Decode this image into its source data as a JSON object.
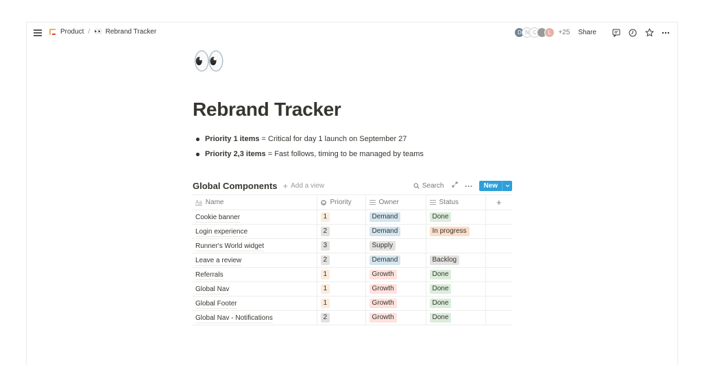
{
  "breadcrumb": {
    "items": [
      {
        "label": "Product",
        "icon": "crane-icon"
      },
      {
        "label": "Rebrand Tracker",
        "icon": "eyes-emoji"
      }
    ],
    "separator": "/"
  },
  "topbar": {
    "avatars": [
      {
        "initial": "D",
        "style": "av-d"
      },
      {
        "initial": "N",
        "style": "av-n"
      },
      {
        "initial": "C",
        "style": "av-c"
      },
      {
        "initial": "",
        "style": "av-p"
      },
      {
        "initial": "L",
        "style": "av-l"
      }
    ],
    "more_count": "+25",
    "share_label": "Share",
    "icons": [
      "comment-icon",
      "history-icon",
      "star-icon",
      "more-icon"
    ]
  },
  "page": {
    "emoji": "👀",
    "title": "Rebrand Tracker",
    "bullets": [
      {
        "bold": "Priority 1 items",
        "text": " = Critical for day 1 launch on September 27"
      },
      {
        "bold": "Priority 2,3 items",
        "text": " = Fast follows, timing to be managed by teams"
      }
    ]
  },
  "database": {
    "title": "Global Components",
    "add_view_label": "Add a view",
    "search_label": "Search",
    "new_label": "New",
    "columns": [
      {
        "label": "Name",
        "icon": "text-icon"
      },
      {
        "label": "Priority",
        "icon": "select-icon"
      },
      {
        "label": "Owner",
        "icon": "list-icon"
      },
      {
        "label": "Status",
        "icon": "list-icon"
      }
    ],
    "rows": [
      {
        "name": "Cookie banner",
        "priority": "1",
        "owner": "Demand",
        "status": "Done"
      },
      {
        "name": "Login experience",
        "priority": "2",
        "owner": "Demand",
        "status": "In progress"
      },
      {
        "name": "Runner's World widget",
        "priority": "3",
        "owner": "Supply",
        "status": ""
      },
      {
        "name": "Leave a review",
        "priority": "2",
        "owner": "Demand",
        "status": "Backlog"
      },
      {
        "name": "Referrals",
        "priority": "1",
        "owner": "Growth",
        "status": "Done"
      },
      {
        "name": "Global Nav",
        "priority": "1",
        "owner": "Growth",
        "status": "Done"
      },
      {
        "name": "Global Footer",
        "priority": "1",
        "owner": "Growth",
        "status": "Done"
      },
      {
        "name": "Global Nav - Notifications",
        "priority": "2",
        "owner": "Growth",
        "status": "Done"
      }
    ],
    "tag_colors": {
      "priority": {
        "1": "#fbecdd",
        "2": "#e3e2e0",
        "3": "#e3e2e0"
      },
      "owner": {
        "Demand": "#d3e5ef",
        "Supply": "#e3e2e0",
        "Growth": "#ffe2dd"
      },
      "status": {
        "Done": "#dbeddb",
        "In progress": "#fadec9",
        "Backlog": "#e3e2e0"
      }
    }
  },
  "colors": {
    "accent": "#2e9fd9",
    "text": "#37352f",
    "muted": "#787774"
  }
}
